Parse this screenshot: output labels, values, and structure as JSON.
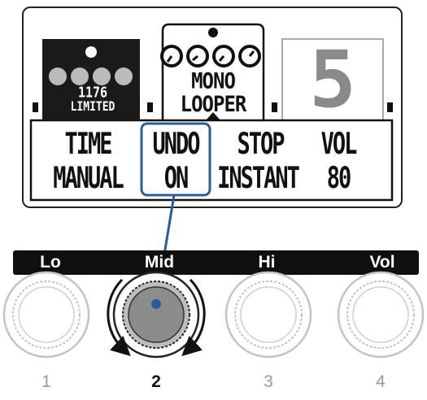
{
  "display": {
    "effects": [
      {
        "name_line1": "1176",
        "name_line2": "LIMITED"
      },
      {
        "name_line1": "MONO",
        "name_line2": "LOOPER"
      },
      {
        "name_line1": "5"
      }
    ],
    "params": [
      {
        "name": "TIME",
        "value": "MANUAL",
        "selected": false
      },
      {
        "name": "UNDO",
        "value": "ON",
        "selected": true
      },
      {
        "name": "STOP",
        "value": "INSTANT",
        "selected": false
      },
      {
        "name": "VOL",
        "value": "80",
        "selected": false
      }
    ]
  },
  "knob_labels": [
    "Lo",
    "Mid",
    "Hi",
    "Vol"
  ],
  "knob_numbers": [
    "1",
    "2",
    "3",
    "4"
  ],
  "colors": {
    "highlight": "#2a5d9a",
    "label_bar": "#0f0f0f",
    "active_knob": "#8c8c8c",
    "inactive_text": "#9a9a9a",
    "active_text": "#111111"
  }
}
